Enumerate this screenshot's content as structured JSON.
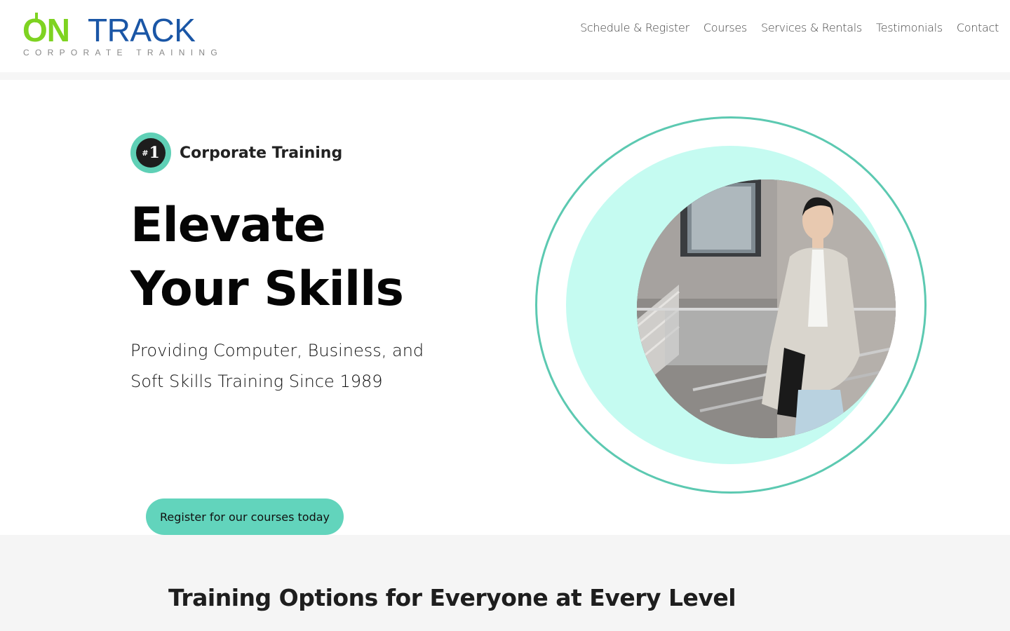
{
  "header": {
    "logo": {
      "brand_primary": "ON",
      "brand_secondary": "TRACK",
      "tagline": "CORPORATE TRAINING",
      "colors": {
        "green": "#7ed321",
        "blue": "#1a56a6"
      }
    },
    "nav": [
      {
        "label": "Schedule & Register"
      },
      {
        "label": "Courses"
      },
      {
        "label": "Services & Rentals"
      },
      {
        "label": "Testimonials"
      },
      {
        "label": "Contact"
      }
    ]
  },
  "hero": {
    "badge": {
      "number": "1",
      "prefix": "#",
      "label": "Corporate Training"
    },
    "title_line1": "Elevate",
    "title_line2": "Your Skills",
    "subtitle_line1": "Providing Computer, Business, and",
    "subtitle_line2": "Soft Skills Training Since 1989",
    "cta_label": "Register for our courses today",
    "image": {
      "description_icon": "woman-walking-photo"
    },
    "colors": {
      "accent": "#62d4bc",
      "mint": "#c5fbf1",
      "ring": "#5cc9b1"
    }
  },
  "section2": {
    "title": "Training Options for Everyone at Every Level"
  }
}
